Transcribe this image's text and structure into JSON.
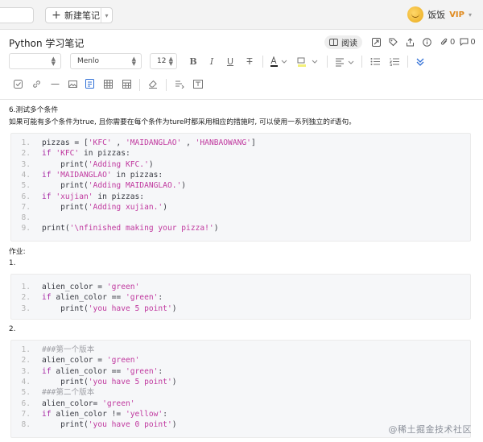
{
  "topbar": {
    "new_note_label": "新建笔记",
    "user_name": "饭饭",
    "vip_label": "VIP"
  },
  "note": {
    "title": "Python 学习笔记",
    "read_label": "阅读",
    "attachment_count": "0",
    "comment_count": "0"
  },
  "toolbar": {
    "font_family": "Menlo",
    "font_size": "12"
  },
  "content": {
    "heading": "6.测试多个条件",
    "description": "如果可能有多个条件为true, 且你需要在每个条件为ture时都采用相应的措施时, 可以使用一系列独立的if语句。",
    "homework_label": "作业:",
    "item1_label": "1.",
    "item2_label": "2."
  },
  "code_blocks": [
    {
      "lines": [
        {
          "n": "1.",
          "segs": [
            [
              "pizzas = [",
              "fn"
            ],
            [
              "'KFC'",
              "st"
            ],
            [
              " , ",
              "fn"
            ],
            [
              "'MAIDANGLAO'",
              "st"
            ],
            [
              " , ",
              "fn"
            ],
            [
              "'HANBAOWANG'",
              "st"
            ],
            [
              "]",
              "fn"
            ]
          ]
        },
        {
          "n": "2.",
          "segs": [
            [
              "if ",
              "kw"
            ],
            [
              "'KFC'",
              "st"
            ],
            [
              " in pizzas:",
              "fn"
            ]
          ]
        },
        {
          "n": "3.",
          "segs": [
            [
              "    print(",
              "fn"
            ],
            [
              "'Adding KFC.'",
              "st"
            ],
            [
              ")",
              "fn"
            ]
          ]
        },
        {
          "n": "4.",
          "segs": [
            [
              "if ",
              "kw"
            ],
            [
              "'MAIDANGLAO'",
              "st"
            ],
            [
              " in pizzas:",
              "fn"
            ]
          ]
        },
        {
          "n": "5.",
          "segs": [
            [
              "    print(",
              "fn"
            ],
            [
              "'Adding MAIDANGLAO.'",
              "st"
            ],
            [
              ")",
              "fn"
            ]
          ]
        },
        {
          "n": "6.",
          "segs": [
            [
              "if ",
              "kw"
            ],
            [
              "'xujian'",
              "st"
            ],
            [
              " in pizzas:",
              "fn"
            ]
          ]
        },
        {
          "n": "7.",
          "segs": [
            [
              "    print(",
              "fn"
            ],
            [
              "'Adding xujian.'",
              "st"
            ],
            [
              ")",
              "fn"
            ]
          ]
        },
        {
          "n": "8.",
          "segs": []
        },
        {
          "n": "9.",
          "segs": [
            [
              "print(",
              "fn"
            ],
            [
              "'\\nfinished making your pizza!'",
              "st"
            ],
            [
              ")",
              "fn"
            ]
          ]
        }
      ]
    },
    {
      "lines": [
        {
          "n": "1.",
          "segs": [
            [
              "alien_color = ",
              "fn"
            ],
            [
              "'green'",
              "st"
            ]
          ]
        },
        {
          "n": "2.",
          "segs": [
            [
              "if ",
              "kw"
            ],
            [
              "alien_color == ",
              "fn"
            ],
            [
              "'green'",
              "st"
            ],
            [
              ":",
              "fn"
            ]
          ]
        },
        {
          "n": "3.",
          "segs": [
            [
              "    print(",
              "fn"
            ],
            [
              "'you have 5 point'",
              "st"
            ],
            [
              ")",
              "fn"
            ]
          ]
        }
      ]
    },
    {
      "lines": [
        {
          "n": "1.",
          "segs": [
            [
              "###第一个版本",
              "cm"
            ]
          ]
        },
        {
          "n": "2.",
          "segs": [
            [
              "alien_color = ",
              "fn"
            ],
            [
              "'green'",
              "st"
            ]
          ]
        },
        {
          "n": "3.",
          "segs": [
            [
              "if ",
              "kw"
            ],
            [
              "alien_color == ",
              "fn"
            ],
            [
              "'green'",
              "st"
            ],
            [
              ":",
              "fn"
            ]
          ]
        },
        {
          "n": "4.",
          "segs": [
            [
              "    print(",
              "fn"
            ],
            [
              "'you have 5 point'",
              "st"
            ],
            [
              ")",
              "fn"
            ]
          ]
        },
        {
          "n": "5.",
          "segs": [
            [
              "###第二个版本",
              "cm"
            ]
          ]
        },
        {
          "n": "6.",
          "segs": [
            [
              "alien_color= ",
              "fn"
            ],
            [
              "'green'",
              "st"
            ]
          ]
        },
        {
          "n": "7.",
          "segs": [
            [
              "if ",
              "kw"
            ],
            [
              "alien_color != ",
              "fn"
            ],
            [
              "'yellow'",
              "st"
            ],
            [
              ":",
              "fn"
            ]
          ]
        },
        {
          "n": "8.",
          "segs": [
            [
              "    print(",
              "fn"
            ],
            [
              "'you have 0 point'",
              "st"
            ],
            [
              ")",
              "fn"
            ]
          ]
        }
      ]
    }
  ],
  "watermark": "@稀土掘金技术社区",
  "colors": {
    "keyword": "#a626a4",
    "string": "#c0399f",
    "comment": "#a0a1a7",
    "active_icon": "#2f6fd6",
    "vip": "#e08a1e"
  }
}
